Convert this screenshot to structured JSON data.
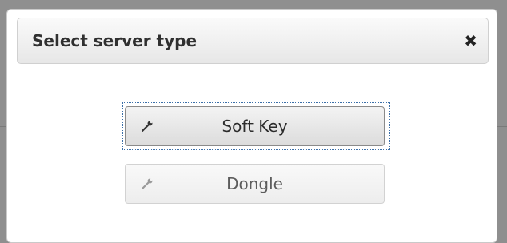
{
  "dialog": {
    "title": "Select server type",
    "close_icon": "close-icon"
  },
  "buttons": [
    {
      "label": "Soft Key",
      "icon": "wrench-icon",
      "enabled": true,
      "focused": true
    },
    {
      "label": "Dongle",
      "icon": "wrench-icon",
      "enabled": false,
      "focused": false
    }
  ]
}
